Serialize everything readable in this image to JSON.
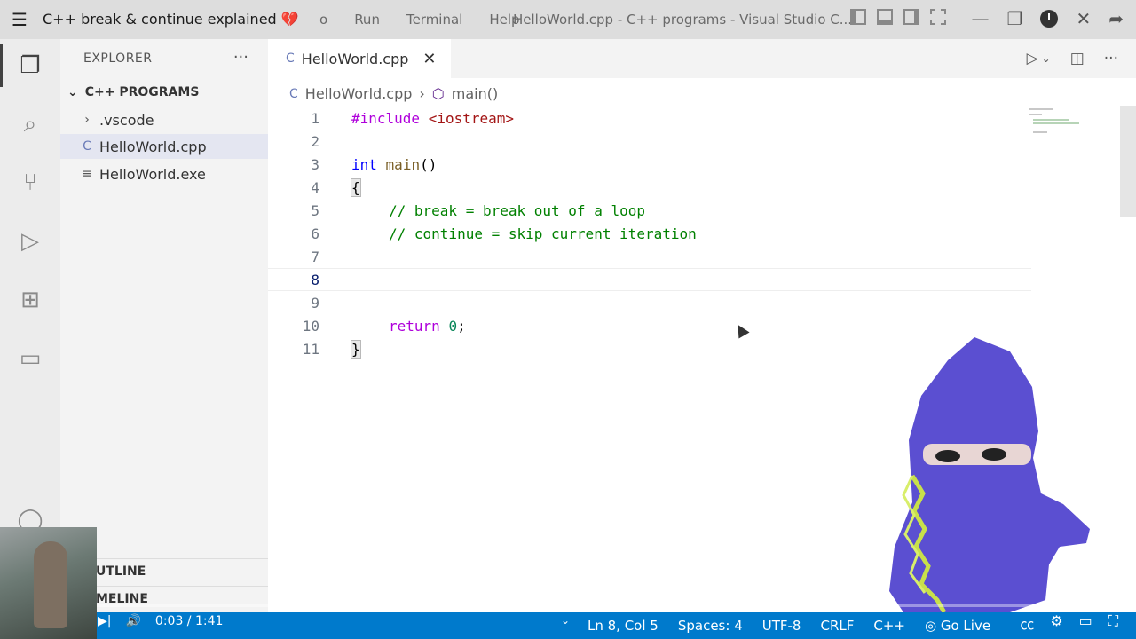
{
  "titlebar": {
    "video_title": "C++ break & continue explained",
    "video_title_suffix": "💔",
    "menu": [
      "o",
      "Run",
      "Terminal",
      "Help"
    ],
    "window_title": "HelloWorld.cpp - C++ programs - Visual Studio C..."
  },
  "sidebar": {
    "header": "EXPLORER",
    "more": "···",
    "folder": "C++ PROGRAMS",
    "items": [
      {
        "label": ".vscode",
        "icon": "chevron-right-icon",
        "glyph": "›"
      },
      {
        "label": "HelloWorld.cpp",
        "icon": "cpp-file-icon",
        "glyph": "C"
      },
      {
        "label": "HelloWorld.exe",
        "icon": "file-lines-icon",
        "glyph": "≡"
      }
    ],
    "outline": "UTLINE",
    "timeline": "MELINE"
  },
  "tab": {
    "label": "HelloWorld.cpp",
    "close": "✕"
  },
  "breadcrumb": {
    "file": "HelloWorld.cpp",
    "sep": "›",
    "symbol": "main()"
  },
  "code": {
    "line_numbers": [
      "1",
      "2",
      "3",
      "4",
      "5",
      "6",
      "7",
      "8",
      "9",
      "10",
      "11"
    ],
    "line1_pp": "#include",
    "line1_header": "<iostream>",
    "line3_type": "int",
    "line3_fn": "main",
    "line3_rest": "()",
    "line4": "{",
    "line5": "// break = break out of a loop",
    "line6": "// continue = skip current iteration",
    "line10_kw": "return",
    "line10_num": "0",
    "line10_semi": ";",
    "line11": "}"
  },
  "statusbar": {
    "ln_col": "Ln 8, Col 5",
    "spaces": "Spaces: 4",
    "encoding": "UTF-8",
    "eol": "CRLF",
    "language": "C++",
    "go_live": "Go Live"
  },
  "player": {
    "time": "0:03 / 1:41",
    "progress": 0.03
  },
  "colors": {
    "accent": "#007acc",
    "progress": "#ff0000"
  }
}
